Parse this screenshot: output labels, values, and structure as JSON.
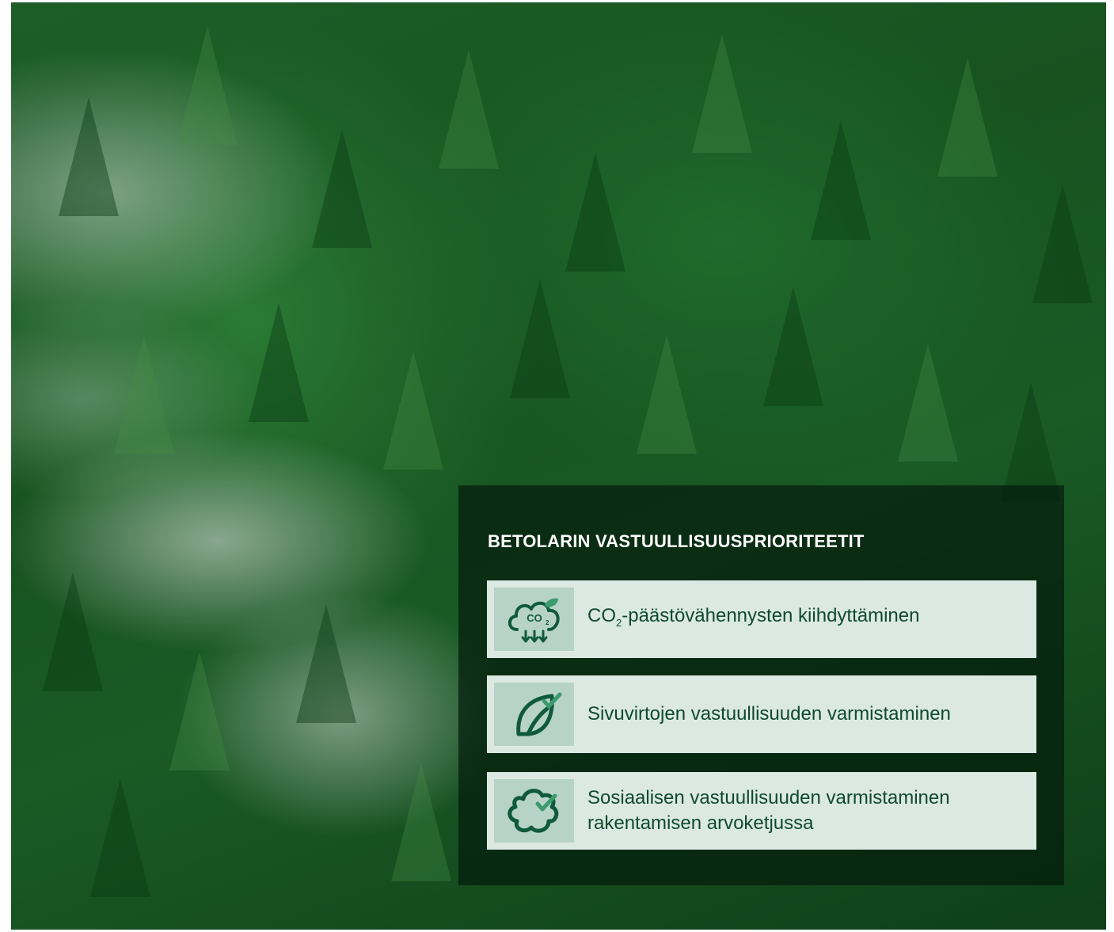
{
  "panel": {
    "title": "BETOLARIN VASTUULLISUUSPRIORITEETIT",
    "items": [
      {
        "icon": "co2-cloud-icon",
        "label_prefix": "CO",
        "label_sub": "2",
        "label_suffix": "-päästövähennysten kiihdyttäminen"
      },
      {
        "icon": "leaf-check-icon",
        "label": "Sivuvirtojen vastuullisuuden varmistaminen"
      },
      {
        "icon": "cloud-check-icon",
        "label": "Sosiaalisen vastuullisuuden varmistaminen rakentamisen arvoketjussa"
      }
    ]
  },
  "colors": {
    "forest": "#1a5a25",
    "panel": "#041c0c",
    "card": "#dce9e3",
    "icon_bg": "#b7d3c7",
    "icon_stroke": "#0f5a3a",
    "check": "#3b9a6e",
    "text": "#0f4a2c"
  }
}
